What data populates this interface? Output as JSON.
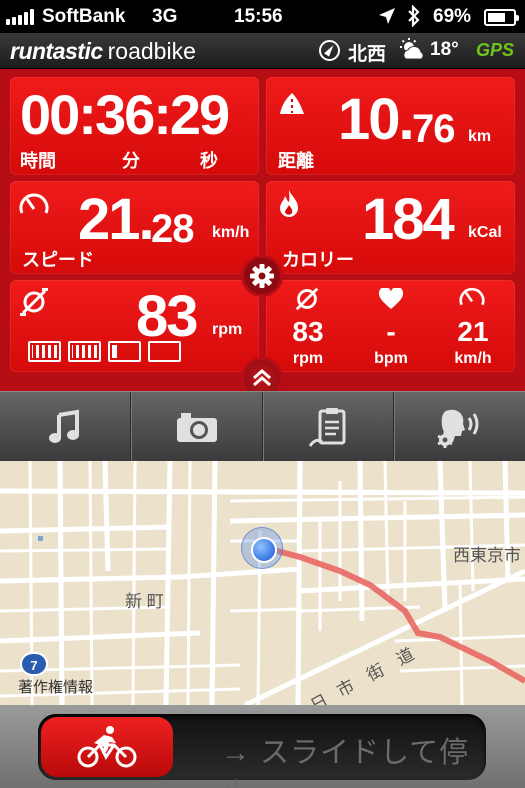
{
  "status_bar": {
    "carrier": "SoftBank",
    "network": "3G",
    "time": "15:56",
    "battery_percent": "69%",
    "battery_level": 0.69
  },
  "header": {
    "brand_primary": "runtastic",
    "brand_secondary": "roadbike",
    "direction": "北西",
    "temperature": "18°",
    "gps_label": "GPS",
    "gps_color": "#6ec51b"
  },
  "dashboard": {
    "duration": {
      "value": "00:36:29",
      "label_hours": "時間",
      "label_minutes": "分",
      "label_seconds": "秒"
    },
    "distance": {
      "integer": "10.",
      "decimal": "76",
      "unit": "km",
      "label": "距離"
    },
    "speed": {
      "integer": "21.",
      "decimal": "28",
      "unit": "km/h",
      "label": "スピード"
    },
    "calories": {
      "value": "184",
      "unit": "kCal",
      "label": "カロリー"
    },
    "cadence": {
      "value": "83",
      "unit": "rpm",
      "gear_segments": [
        "full",
        "full",
        "half",
        "empty"
      ]
    },
    "mini_stats": [
      {
        "name": "cadence",
        "value": "83",
        "unit": "rpm"
      },
      {
        "name": "heart-rate",
        "value": "-",
        "unit": "bpm"
      },
      {
        "name": "speed",
        "value": "21",
        "unit": "km/h"
      }
    ],
    "accent_color": "#e01414"
  },
  "toolbar": {
    "items": [
      "music",
      "camera",
      "clipboard",
      "voice-coach"
    ]
  },
  "map": {
    "labels": {
      "district": "新 町",
      "city_edge": "西東京市",
      "street": "市 街 道",
      "street_prefix": "日"
    },
    "route_badge": "7",
    "copyright": "著作権情報",
    "route_color": "#e8605c"
  },
  "slider": {
    "label": "→ スライドして停止"
  }
}
